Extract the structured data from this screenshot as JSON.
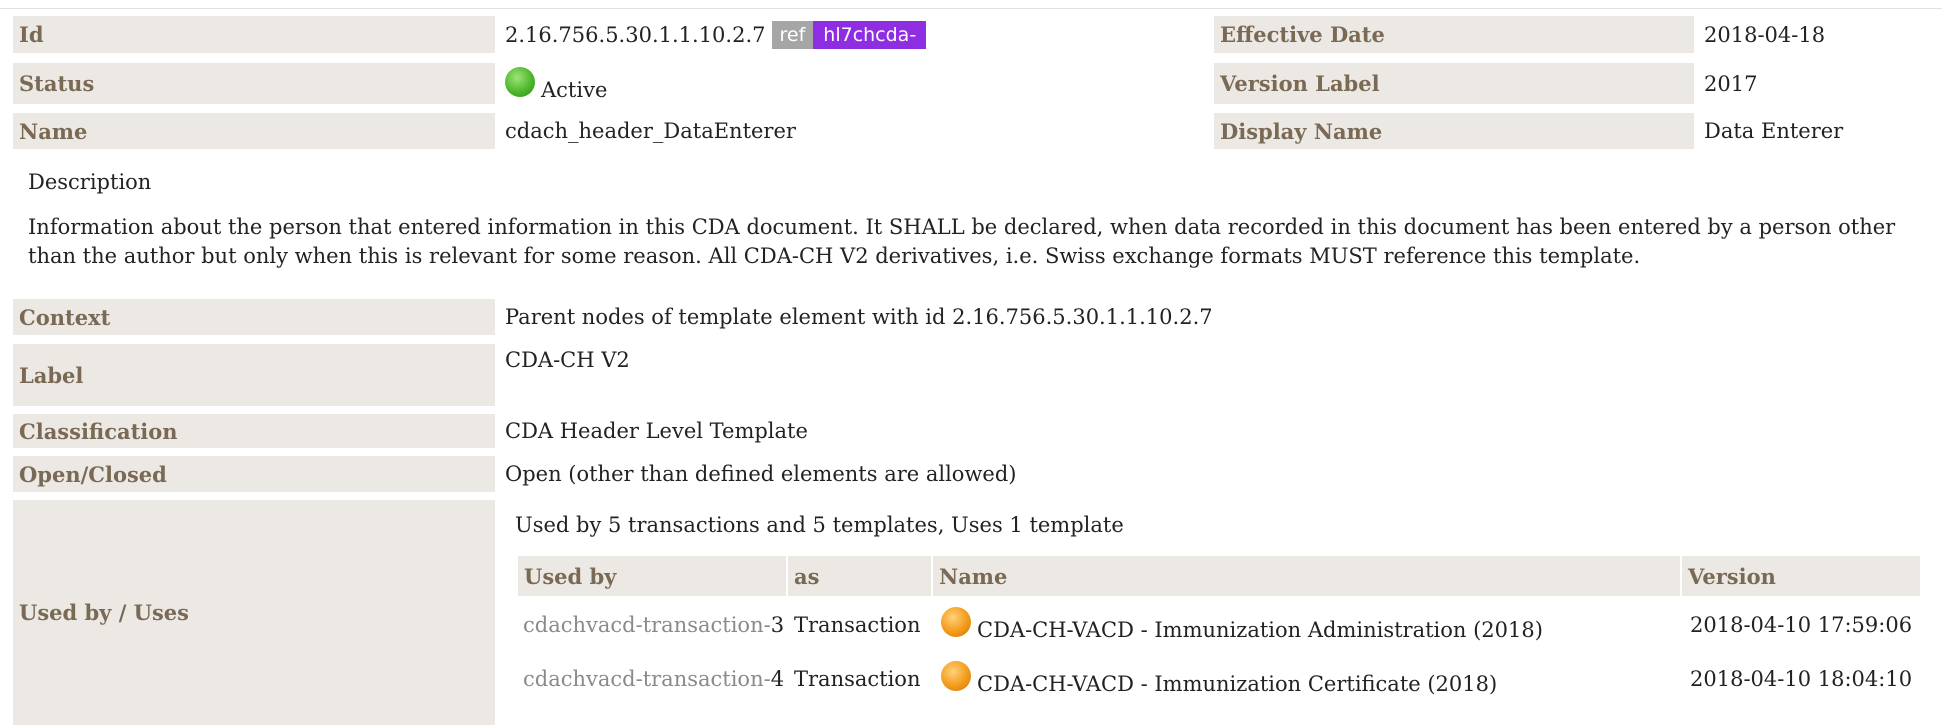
{
  "header": {
    "id_label": "Id",
    "id_value": "2.16.756.5.30.1.1.10.2.7",
    "ref_badge": "ref",
    "prefix_badge": "hl7chcda-",
    "effective_date_label": "Effective Date",
    "effective_date_value": "2018-04-18",
    "status_label": "Status",
    "status_value": "Active",
    "version_label_label": "Version Label",
    "version_label_value": "2017",
    "name_label": "Name",
    "name_value": "cdach_header_DataEnterer",
    "display_name_label": "Display Name",
    "display_name_value": "Data Enterer"
  },
  "description": {
    "title": "Description",
    "text": "Information about the person that entered information in this CDA document. It SHALL be declared, when data recorded in this document has been entered by a person other than the author but only when this is relevant for some reason. All CDA-CH V2 derivatives, i.e. Swiss exchange formats MUST reference this template."
  },
  "details": {
    "context_label": "Context",
    "context_value": "Parent nodes of template element with id 2.16.756.5.30.1.1.10.2.7",
    "label_label": "Label",
    "label_value": "CDA-CH V2",
    "classification_label": "Classification",
    "classification_value": "CDA Header Level Template",
    "open_closed_label": "Open/Closed",
    "open_closed_value": "Open (other than defined elements are allowed)",
    "used_by_label": "Used by / Uses"
  },
  "usage": {
    "summary": "Used by 5 transactions and 5 templates, Uses 1 template",
    "columns": [
      "Used by",
      "as",
      "Name",
      "Version"
    ],
    "rows": [
      {
        "prefix": "cdachvacd-transaction-",
        "num": "3",
        "as": "Transaction",
        "name": "CDA-CH-VACD - Immunization Administration (2018)",
        "version": "2018-04-10 17:59:06"
      },
      {
        "prefix": "cdachvacd-transaction-",
        "num": "4",
        "as": "Transaction",
        "name": "CDA-CH-VACD - Immunization Certificate (2018)",
        "version": "2018-04-10 18:04:10"
      }
    ]
  },
  "colors": {
    "label_bg": "#ece9e4",
    "label_text": "#7a6a55",
    "prefix_badge": "#8e2de2",
    "ref_badge": "#a6a6a6",
    "status_active": "#4db82b",
    "status_draft": "#f39a1a"
  }
}
